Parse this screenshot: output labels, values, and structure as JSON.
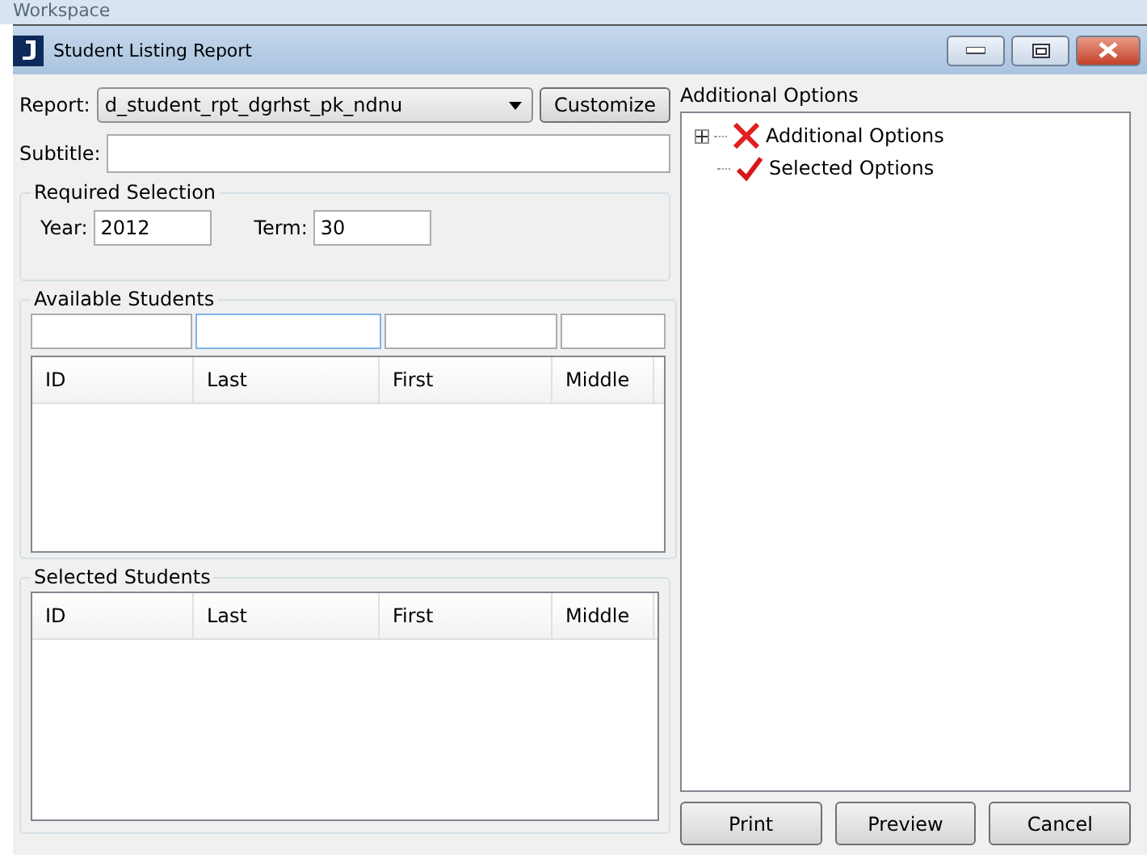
{
  "workspace_label": "Workspace",
  "window": {
    "title": "Student Listing Report"
  },
  "report": {
    "label": "Report:",
    "value": "d_student_rpt_dgrhst_pk_ndnu",
    "customize_button": "Customize"
  },
  "subtitle": {
    "label": "Subtitle:"
  },
  "required_selection": {
    "title": "Required Selection",
    "year": {
      "label": "Year:",
      "value": "2012"
    },
    "term": {
      "label": "Term:",
      "value": "30"
    }
  },
  "available_students": {
    "title": "Available Students",
    "filters": [
      {
        "focused": false
      },
      {
        "focused": true
      },
      {
        "focused": false
      },
      {
        "focused": false
      }
    ],
    "columns": [
      "ID",
      "Last",
      "First",
      "Middle"
    ]
  },
  "selected_students": {
    "title": "Selected Students",
    "columns": [
      "ID",
      "Last",
      "First",
      "Middle"
    ]
  },
  "additional_options": {
    "title": "Additional Options",
    "tree": [
      {
        "label": "Additional Options",
        "kind": "cross",
        "expandable": true
      },
      {
        "label": "Selected Options",
        "kind": "check",
        "expandable": false
      }
    ]
  },
  "buttons": [
    "Print",
    "Preview",
    "Cancel"
  ]
}
